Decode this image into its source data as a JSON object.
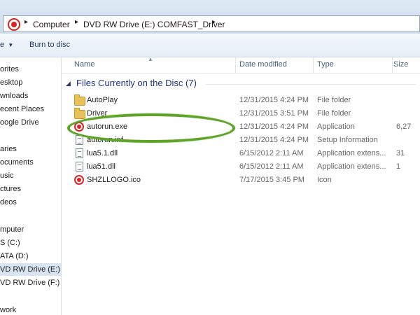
{
  "address": {
    "crumbs": [
      "Computer",
      "DVD RW Drive (E:) COMFAST_Driver"
    ]
  },
  "toolbar": {
    "organize_fragment": "e",
    "burn_label": "Burn to disc"
  },
  "nav": {
    "items": [
      {
        "label": "orites"
      },
      {
        "label": "esktop"
      },
      {
        "label": "wnloads"
      },
      {
        "label": "ecent Places"
      },
      {
        "label": "oogle Drive"
      },
      {
        "label": "aries"
      },
      {
        "label": "ocuments"
      },
      {
        "label": "usic"
      },
      {
        "label": "ctures"
      },
      {
        "label": "deos"
      },
      {
        "label": "mputer"
      },
      {
        "label": "S (C:)"
      },
      {
        "label": "ATA (D:)"
      },
      {
        "label": "VD RW Drive (E:) C"
      },
      {
        "label": "VD RW Drive (F:)"
      },
      {
        "label": "work"
      }
    ]
  },
  "columns": {
    "name": "Name",
    "date": "Date modified",
    "type": "Type",
    "size": "Size"
  },
  "group": {
    "title": "Files Currently on the Disc (7)"
  },
  "files": [
    {
      "name": "AutoPlay",
      "date": "12/31/2015 4:24 PM",
      "type": "File folder",
      "size": "",
      "icon": "folder-icon"
    },
    {
      "name": "Driver",
      "date": "12/31/2015 3:51 PM",
      "type": "File folder",
      "size": "",
      "icon": "folder-icon"
    },
    {
      "name": "autorun.exe",
      "date": "12/31/2015 4:24 PM",
      "type": "Application",
      "size": "6,27",
      "icon": "app-icon"
    },
    {
      "name": "autorun.inf",
      "date": "12/31/2015 4:24 PM",
      "type": "Setup Information",
      "size": "",
      "icon": "settings-file-icon"
    },
    {
      "name": "lua5.1.dll",
      "date": "6/15/2012 2:11 AM",
      "type": "Application extens...",
      "size": "31",
      "icon": "dll-file-icon"
    },
    {
      "name": "lua51.dll",
      "date": "6/15/2012 2:11 AM",
      "type": "Application extens...",
      "size": "1",
      "icon": "dll-file-icon"
    },
    {
      "name": "SHZLLOGO.ico",
      "date": "7/17/2015 3:45 PM",
      "type": "Icon",
      "size": "",
      "icon": "ico-file-icon"
    }
  ],
  "colors": {
    "highlight": "#5fa428",
    "group_title": "#1e3287",
    "brand_red": "#d92323"
  }
}
